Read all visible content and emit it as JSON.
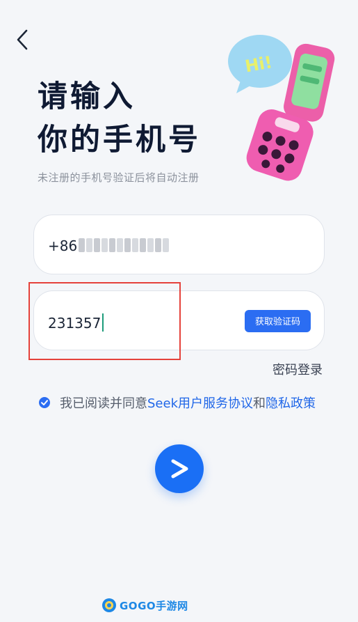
{
  "header": {
    "title_line1": "请输入",
    "title_line2": "你的手机号",
    "subtitle": "未注册的手机号验证后将自动注册"
  },
  "illustration": {
    "bubble_text": "Hi!"
  },
  "phone": {
    "prefix": "+86"
  },
  "verification": {
    "value": "231357",
    "get_code_label": "获取验证码"
  },
  "password_login_label": "密码登录",
  "agreement": {
    "prefix": "我已阅读并同意",
    "terms_link": "Seek用户服务协议",
    "conjunction": "和",
    "privacy_link": "隐私政策"
  },
  "watermark": {
    "text": "GOGO手游网"
  },
  "colors": {
    "accent": "#2b6df2",
    "highlight_border": "#e5413a"
  }
}
